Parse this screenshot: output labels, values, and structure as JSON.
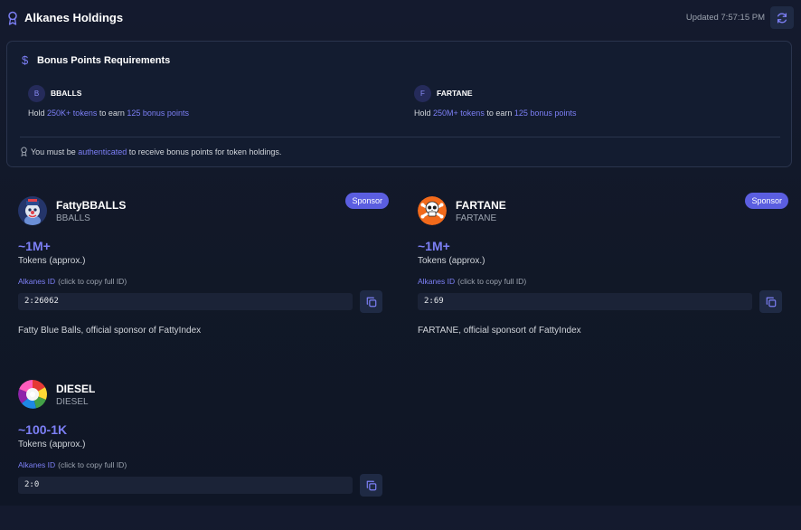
{
  "header": {
    "title": "Alkanes Holdings",
    "updated": "Updated 7:57:15 PM"
  },
  "bonus": {
    "title": "Bonus Points Requirements",
    "requirements": [
      {
        "letter": "B",
        "name": "BBALLS",
        "hold": "Hold",
        "amount": "250K+ tokens",
        "earn": "to earn",
        "points": "125 bonus points"
      },
      {
        "letter": "F",
        "name": "FARTANE",
        "hold": "Hold",
        "amount": "250M+ tokens",
        "earn": "to earn",
        "points": "125 bonus points"
      }
    ],
    "note": {
      "before": "You must be",
      "link": "authenticated",
      "after": "to receive bonus points for token holdings."
    }
  },
  "tokens": [
    {
      "name": "FattyBBALLS",
      "symbol": "BBALLS",
      "badge": "Sponsor",
      "amount": "~1M+",
      "amount_label": "Tokens (approx.)",
      "id_label": "Alkanes ID",
      "id_hint": "(click to copy full ID)",
      "id": "2:26062",
      "description": "Fatty Blue Balls, official sponsor of FattyIndex",
      "avatar": "clown-avatar"
    },
    {
      "name": "FARTANE",
      "symbol": "FARTANE",
      "badge": "Sponsor",
      "amount": "~1M+",
      "amount_label": "Tokens (approx.)",
      "id_label": "Alkanes ID",
      "id_hint": "(click to copy full ID)",
      "id": "2:69",
      "description": "FARTANE, official sponsort of FattyIndex",
      "avatar": "skull-crossbones-avatar"
    },
    {
      "name": "DIESEL",
      "symbol": "DIESEL",
      "amount": "~100-1K",
      "amount_label": "Tokens (approx.)",
      "id_label": "Alkanes ID",
      "id_hint": "(click to copy full ID)",
      "id": "2:0",
      "avatar": "rainbow-orb-avatar"
    }
  ],
  "colors": {
    "accent": "#7c7ff5",
    "badge": "#5b5ee0",
    "background": "#111827"
  }
}
